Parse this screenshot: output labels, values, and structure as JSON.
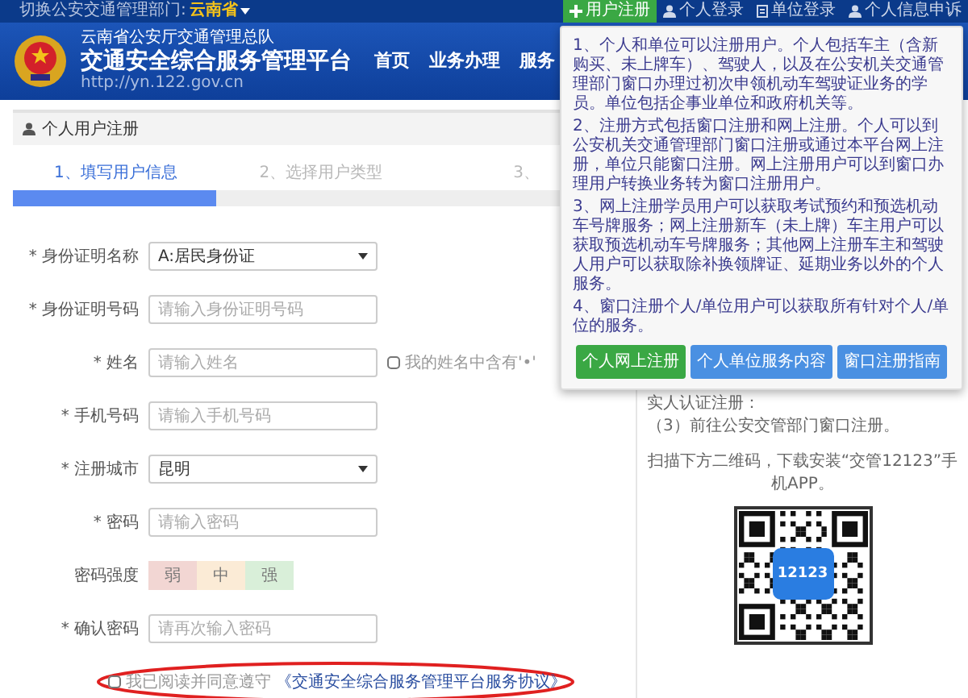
{
  "top_bar": {
    "switch_label": "切换公安交通管理部门:",
    "region": "云南省",
    "links": [
      {
        "label": "用户注册",
        "kind": "plus",
        "selected": true
      },
      {
        "label": "个人登录",
        "kind": "user",
        "selected": false
      },
      {
        "label": "单位登录",
        "kind": "doc",
        "selected": false
      },
      {
        "label": "个人信息申诉",
        "kind": "user",
        "selected": false
      }
    ]
  },
  "header": {
    "subtitle": "云南省公安厅交通管理总队",
    "title": "交通安全综合服务管理平台",
    "url": "http://yn.122.gov.cn",
    "nav": [
      "首页",
      "业务办理",
      "服务"
    ]
  },
  "panel": {
    "title": "个人用户注册",
    "steps": [
      {
        "label": "1、填写用户信息",
        "selected": true
      },
      {
        "label": "2、选择用户类型",
        "selected": false
      },
      {
        "label": "3、",
        "selected": false
      }
    ],
    "progress": {
      "level": 0.33
    }
  },
  "form": [
    {
      "kind": "select",
      "label": "* 身份证明名称",
      "value": "A:居民身份证"
    },
    {
      "kind": "input",
      "label": "* 身份证明号码",
      "placeholder": "请输入身份证明号码"
    },
    {
      "kind": "input",
      "label": "* 姓名",
      "placeholder": "请输入姓名",
      "checkbox": {
        "label": "我的姓名中含有'•'",
        "checked": false
      }
    },
    {
      "kind": "input",
      "label": "* 手机号码",
      "placeholder": "请输入手机号码"
    },
    {
      "kind": "select",
      "label": "* 注册城市",
      "value": "昆明"
    },
    {
      "kind": "input",
      "label": "* 密码",
      "placeholder": "请输入密码"
    },
    {
      "kind": "strength",
      "label": "密码强度",
      "levels": [
        {
          "label": "弱",
          "color": "#f2d6d3"
        },
        {
          "label": "中",
          "color": "#fbebd6"
        },
        {
          "label": "强",
          "color": "#d9efd9"
        }
      ]
    },
    {
      "kind": "input",
      "label": "* 确认密码",
      "placeholder": "请再次输入密码"
    }
  ],
  "agreement": {
    "checked": false,
    "text": "我已阅读并同意遵守",
    "link": "《交通安全综合服务管理平台服务协议》"
  },
  "popup": {
    "paragraphs": [
      "1、个人和单位可以注册用户。个人包括车主（含新购买、未上牌车）、驾驶人，以及在公安机关交通管理部门窗口办理过初次申领机动车驾驶证业务的学员。单位包括企事业单位和政府机关等。",
      "2、注册方式包括窗口注册和网上注册。个人可以到公安机关交通管理部门窗口注册或通过本平台网上注册，单位只能窗口注册。网上注册用户可以到窗口办理用户转换业务转为窗口注册用户。",
      "3、网上注册学员用户可以获取考试预约和预选机动车号牌服务；网上注册新车（未上牌）车主用户可以获取预选机动车号牌服务；其他网上注册车主和驾驶人用户可以获取除补换领牌证、延期业务以外的个人服务。",
      "4、窗口注册个人/单位用户可以获取所有针对个人/单位的服务。"
    ],
    "buttons": [
      {
        "label": "个人网上注册",
        "kind": "green"
      },
      {
        "label": "个人单位服务内容",
        "kind": "blue"
      },
      {
        "label": "窗口注册指南",
        "kind": "blue"
      }
    ]
  },
  "side": {
    "lines": [
      "实人认证注册：",
      "（3）前往公安交管部门窗口注册。"
    ],
    "scan_text": "扫描下方二维码，下载安装“交管12123”手机APP。",
    "qr_logo": "12123"
  }
}
